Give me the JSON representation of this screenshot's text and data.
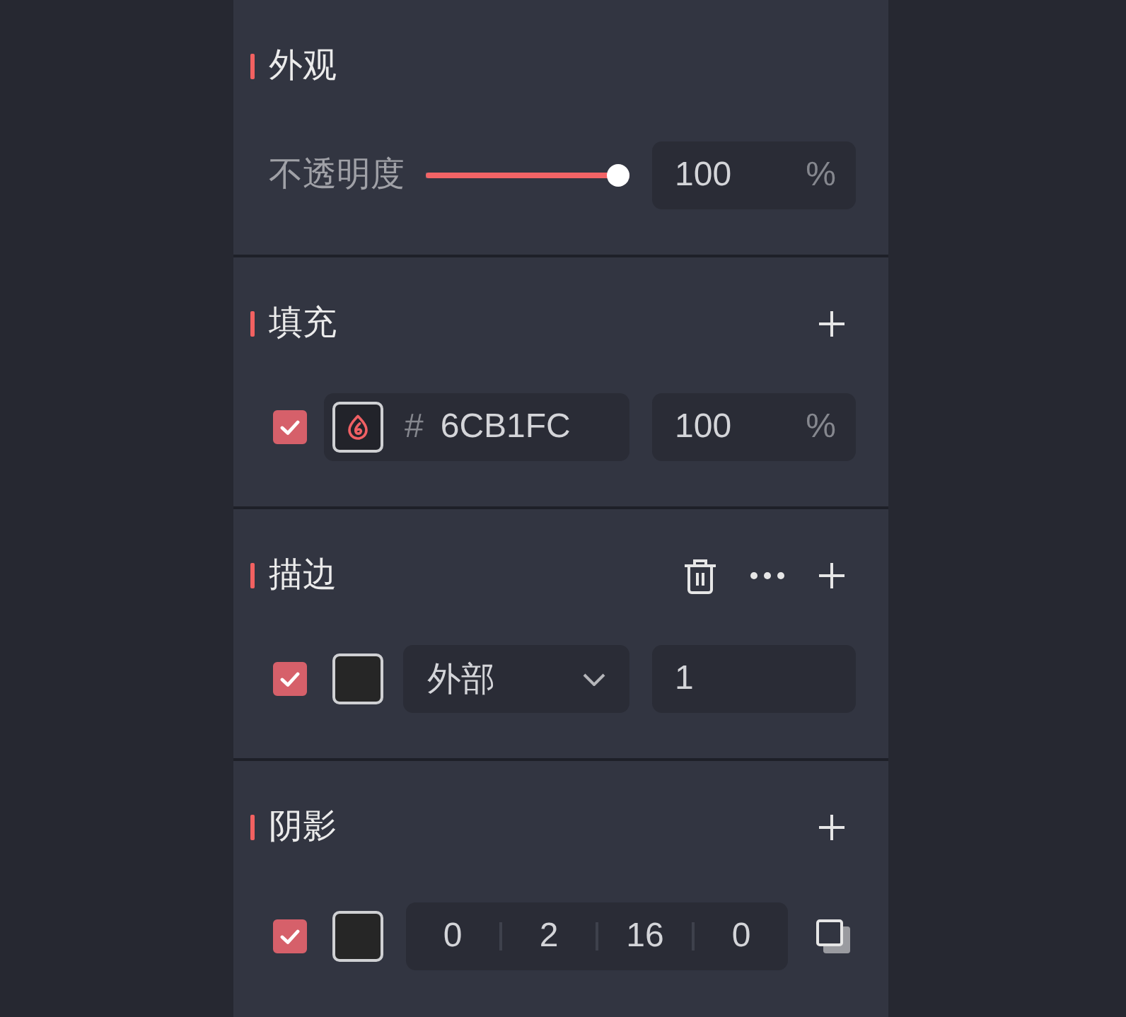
{
  "sections": [
    {
      "title": "外观",
      "rows": [
        {
          "kind": "opacity",
          "label": "不透明度",
          "level": 1,
          "value": "100",
          "unit": "%"
        }
      ]
    },
    {
      "title": "填充",
      "actions": [
        {
          "kind": "add"
        }
      ],
      "rows": [
        {
          "kind": "fill",
          "checked": true,
          "hash": "#",
          "hex": "6CB1FC",
          "value": "100",
          "unit": "%"
        }
      ]
    },
    {
      "title": "描边",
      "actions": [
        {
          "kind": "delete"
        },
        {
          "kind": "more"
        },
        {
          "kind": "add"
        }
      ],
      "rows": [
        {
          "kind": "stroke",
          "checked": true,
          "color": "#262626",
          "position": "外部",
          "value": "1"
        }
      ]
    },
    {
      "title": "阴影",
      "actions": [
        {
          "kind": "add"
        }
      ],
      "rows": [
        {
          "kind": "shadow",
          "checked": true,
          "color": "#262626",
          "values": [
            "0",
            "2",
            "16",
            "0"
          ]
        }
      ]
    }
  ]
}
